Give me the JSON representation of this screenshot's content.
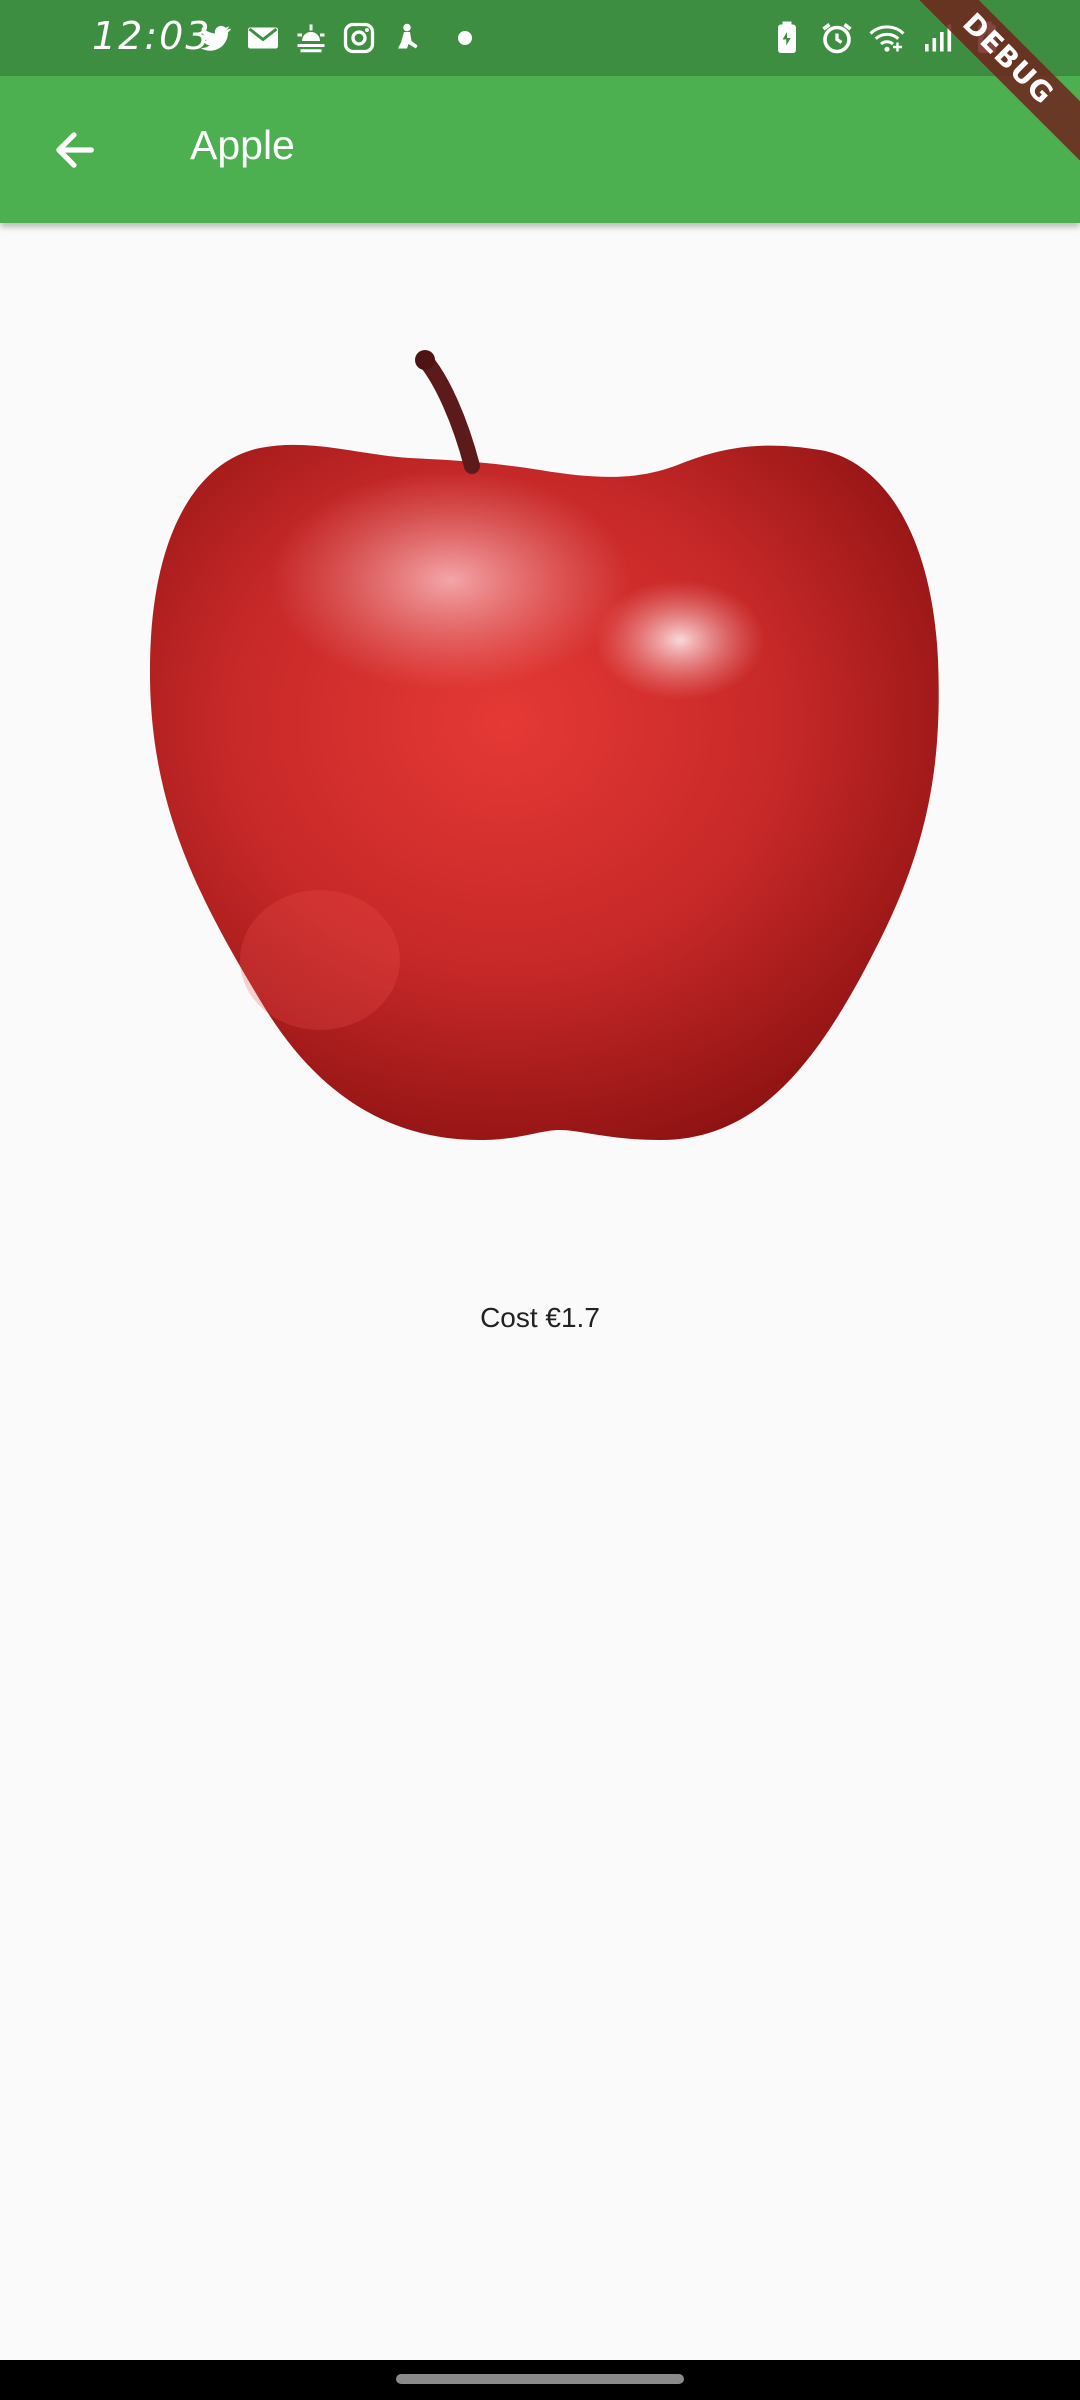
{
  "status_bar": {
    "time": "12:03",
    "left_icons": [
      "twitter-icon",
      "email-icon",
      "weather-icon",
      "instagram-icon",
      "accessibility-icon",
      "notification-dot-icon"
    ],
    "right_icons": [
      "battery-saver-icon",
      "alarm-icon",
      "wifi-icon",
      "signal-icon",
      "battery-charging-icon"
    ]
  },
  "app_bar": {
    "title": "Apple",
    "back_icon": "arrow-back-icon",
    "color": "#4caf50"
  },
  "debug_banner": {
    "label": "DEBUG"
  },
  "product": {
    "image": "apple-image",
    "price_text": "Cost €1.7"
  },
  "colors": {
    "status_bar": "#3e8e41",
    "app_bar": "#4caf50",
    "background": "#fafafa"
  }
}
